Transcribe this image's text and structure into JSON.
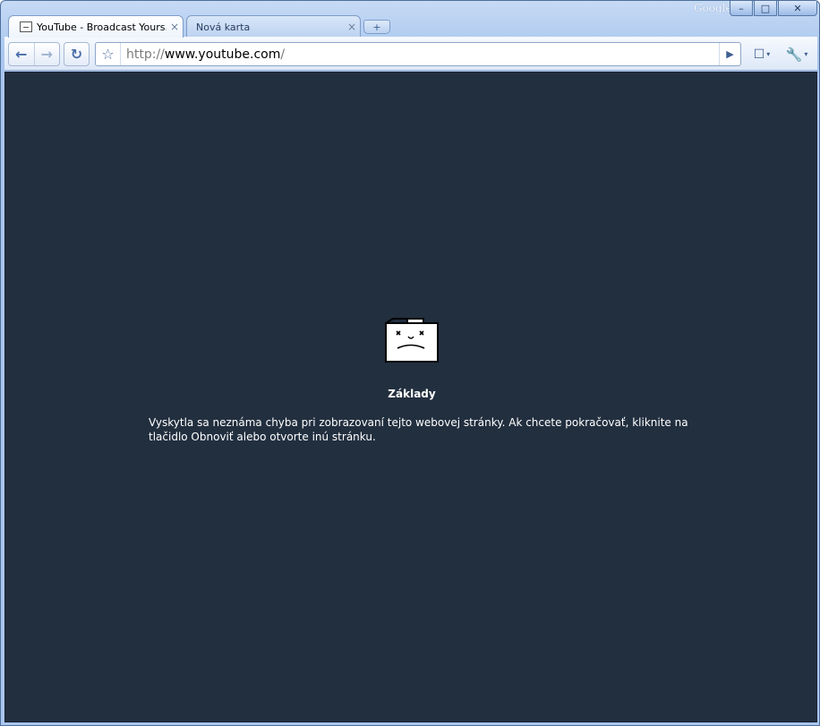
{
  "window": {
    "brand": "Google",
    "controls": {
      "minimize": "–",
      "maximize": "□",
      "close": "✕"
    }
  },
  "tabs": [
    {
      "title": "YouTube - Broadcast Yours...",
      "close": "×",
      "active": true,
      "icon": "sad-page-favicon"
    },
    {
      "title": "Nová karta",
      "close": "×",
      "active": false
    }
  ],
  "new_tab": "+",
  "toolbar": {
    "back": "←",
    "forward": "→",
    "reload": "↻",
    "star": "☆",
    "url_scheme": "http://",
    "url_host": "www.youtube.com",
    "url_path": "/",
    "go": "▶",
    "page_menu": "☐",
    "wrench": "🔧",
    "dropdown": "▾"
  },
  "error_page": {
    "icon": "sad-folder-icon",
    "title": "Základy",
    "message": "Vyskytla sa neznáma chyba pri zobrazovaní tejto webovej stránky. Ak chcete pokračovať, kliknite na tlačidlo Obnoviť alebo otvorte inú stránku."
  },
  "colors": {
    "content_bg": "#222f3f",
    "frame": "#a9c6ee",
    "accent": "#4a6ea8"
  }
}
